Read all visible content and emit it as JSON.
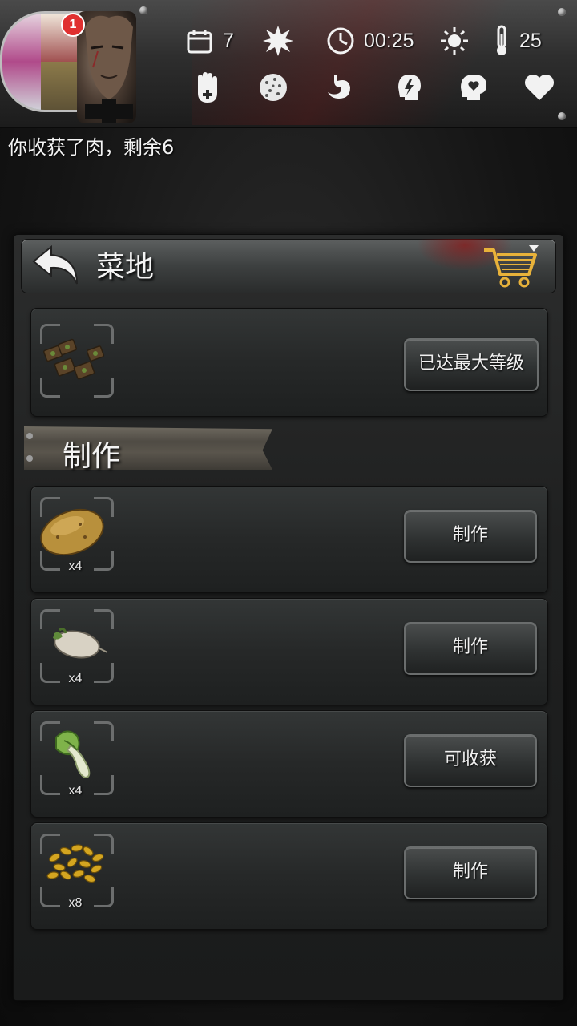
{
  "hud": {
    "days": "7",
    "time": "00:25",
    "temperature": "25",
    "notification_count": "1",
    "icons": [
      "calendar-icon",
      "sun-burst-icon",
      "clock-icon",
      "weather-sun-icon",
      "thermometer-icon",
      "health-hand-icon",
      "disease-icon",
      "stomach-icon",
      "energy-head-icon",
      "mood-head-icon",
      "heart-icon"
    ]
  },
  "message": "你收获了肉，剩余6",
  "panel": {
    "title": "菜地",
    "upgrade_button": "已达最大等级",
    "section_title": "制作",
    "items": [
      {
        "name": "potato",
        "qty": "x4",
        "button": "制作"
      },
      {
        "name": "turnip",
        "qty": "x4",
        "button": "制作"
      },
      {
        "name": "bok-choy",
        "qty": "x4",
        "button": "可收获"
      },
      {
        "name": "grain-seeds",
        "qty": "x8",
        "button": "制作"
      }
    ]
  },
  "colors": {
    "accent_red": "#e03030",
    "panel_bg": "#1f2020",
    "text": "#f4f4f4"
  }
}
